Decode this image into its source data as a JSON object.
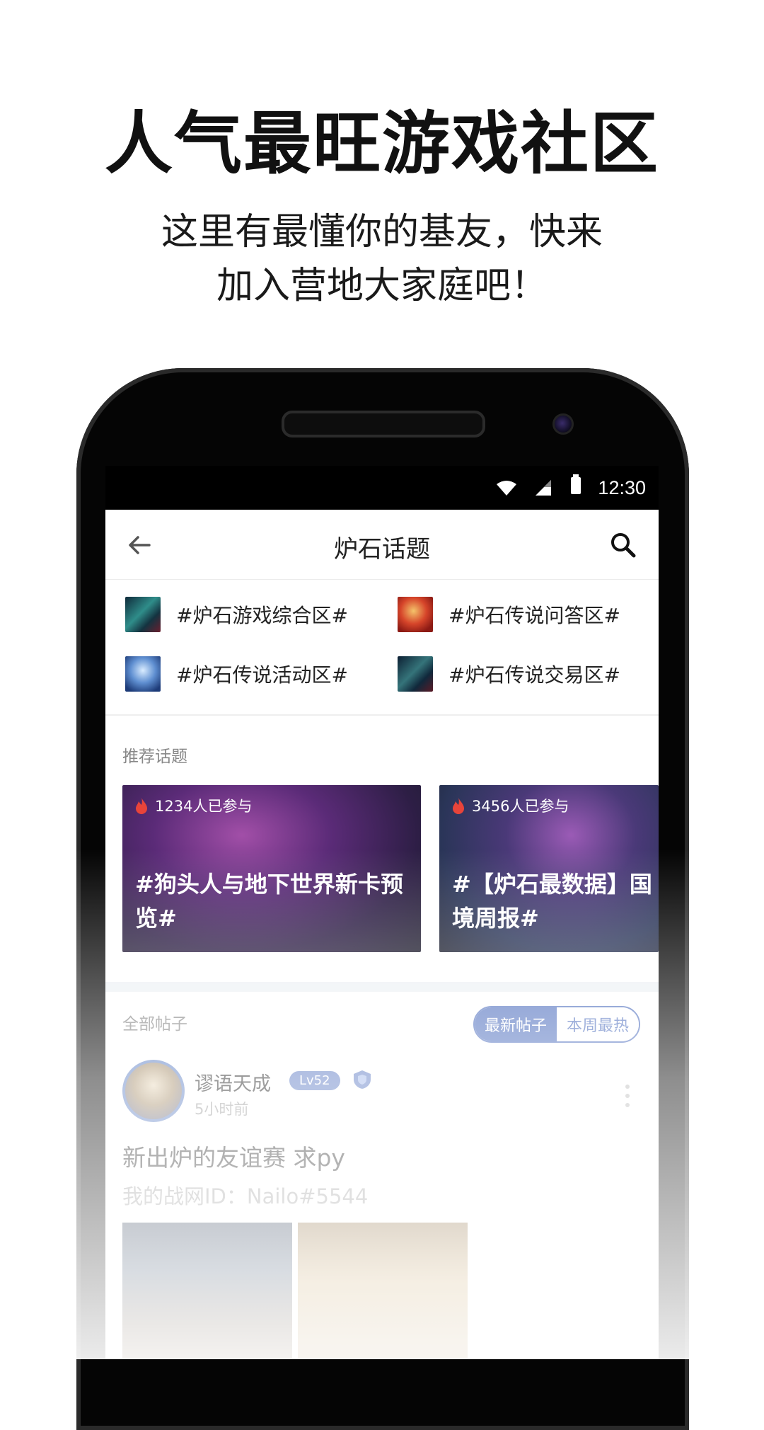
{
  "promo": {
    "headline": "人气最旺游戏社区",
    "subline_1": "这里有最懂你的基友，快来",
    "subline_2": "加入营地大家庭吧！"
  },
  "status_bar": {
    "time": "12:30"
  },
  "app_bar": {
    "title": "炉石话题"
  },
  "topic_links": [
    {
      "label": "#炉石游戏综合区#"
    },
    {
      "label": "#炉石传说问答区#"
    },
    {
      "label": "#炉石传说活动区#"
    },
    {
      "label": "#炉石传说交易区#"
    }
  ],
  "recommended": {
    "label": "推荐话题",
    "cards": [
      {
        "count": "1234人已参与",
        "title": "#狗头人与地下世界新卡预览#"
      },
      {
        "count": "3456人已参与",
        "title": "#【炉石最数据】国境周报#"
      }
    ]
  },
  "posts": {
    "label": "全部帖子",
    "tab_latest": "最新帖子",
    "tab_hot": "本周最热",
    "post": {
      "username": "谬语天成",
      "level": "Lv52",
      "time": "5小时前",
      "title": "新出炉的友谊赛 求py",
      "body": "我的战网ID：Nailo#5544"
    }
  },
  "colors": {
    "accent": "#5a78c2",
    "flame": "#e8443a"
  }
}
